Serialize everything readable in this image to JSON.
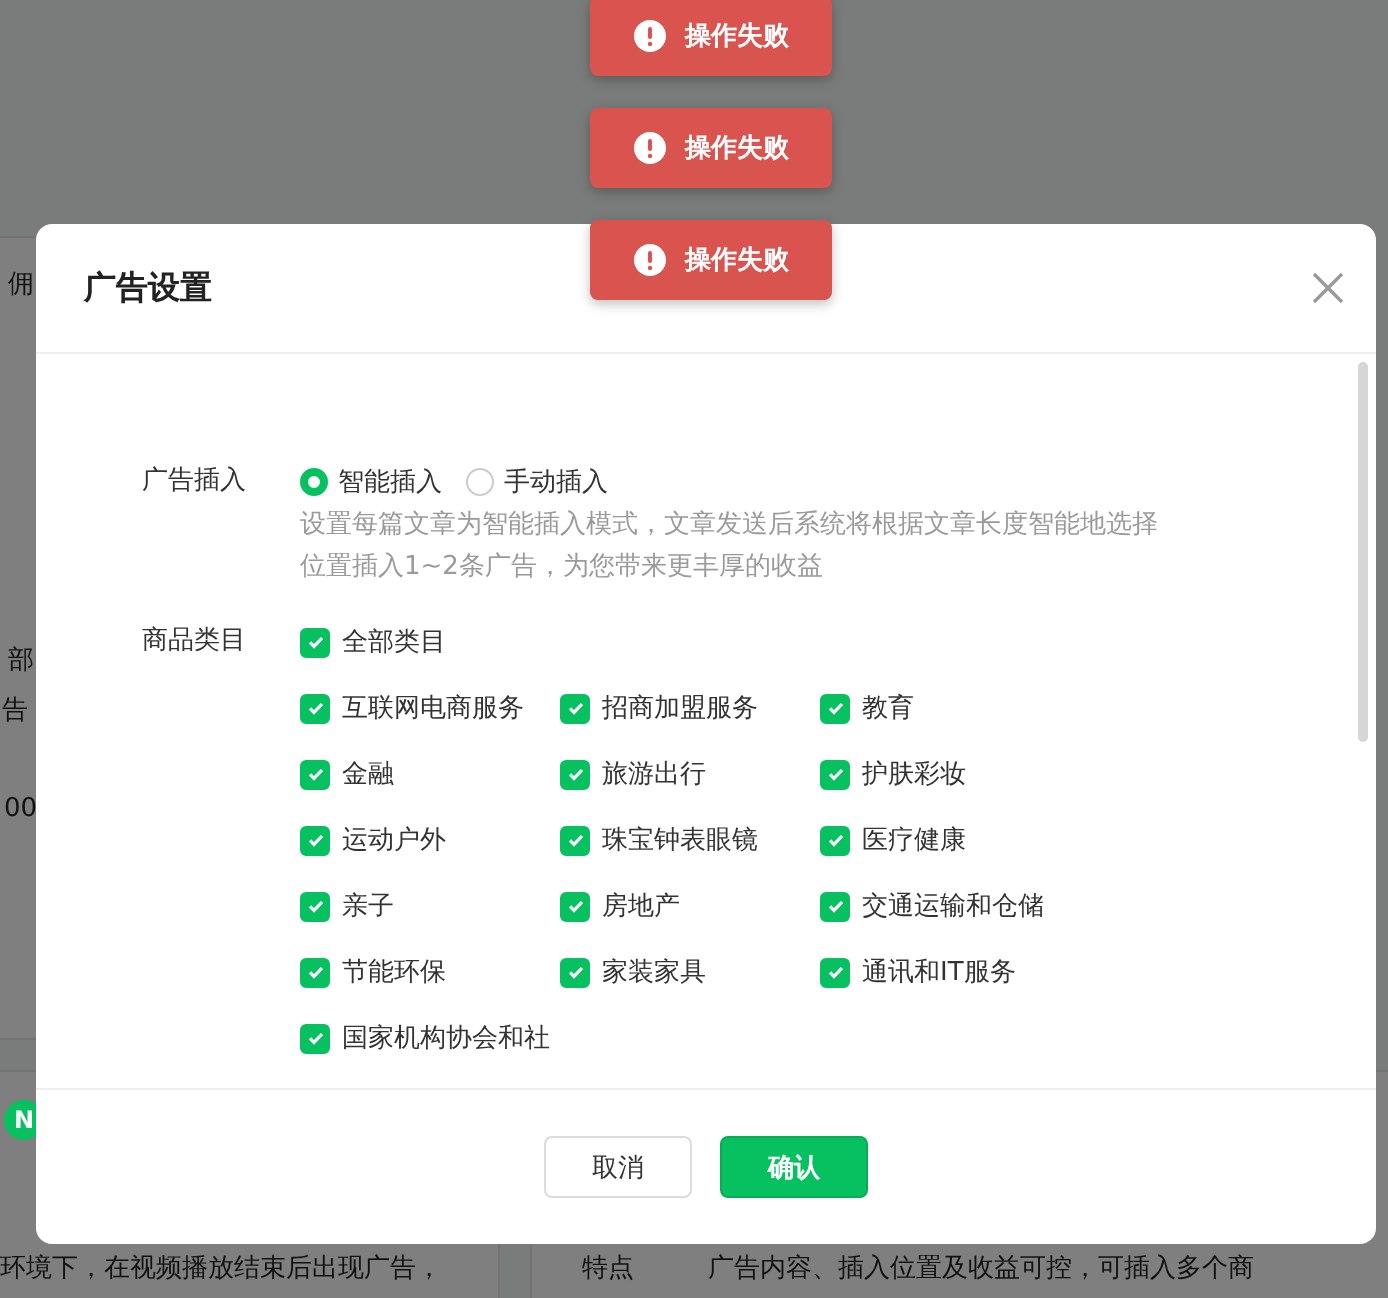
{
  "background": {
    "fragments": [
      {
        "kind": "text",
        "text": "佣"
      },
      {
        "kind": "text",
        "text": "部"
      },
      {
        "kind": "text",
        "text": "告"
      },
      {
        "kind": "text",
        "text": "00"
      },
      {
        "kind": "badge",
        "text": "N"
      },
      {
        "kind": "text",
        "text": "环境下，在视频播放结束后出现广告，"
      },
      {
        "kind": "text",
        "text": "特点"
      },
      {
        "kind": "text",
        "text": "广告内容、插入位置及收益可控，可插入多个商"
      }
    ]
  },
  "dialog": {
    "title": "广告设置",
    "ad_insert": {
      "label": "广告插入",
      "options": [
        {
          "label": "智能插入",
          "selected": true
        },
        {
          "label": "手动插入",
          "selected": false
        }
      ],
      "hint": "设置每篇文章为智能插入模式，文章发送后系统将根据文章长度智能地选择位置插入1~2条广告，为您带来更丰厚的收益"
    },
    "categories": {
      "label": "商品类目",
      "all": {
        "label": "全部类目",
        "checked": true
      },
      "items": [
        {
          "label": "互联网电商服务",
          "checked": true
        },
        {
          "label": "招商加盟服务",
          "checked": true
        },
        {
          "label": "教育",
          "checked": true
        },
        {
          "label": "金融",
          "checked": true
        },
        {
          "label": "旅游出行",
          "checked": true
        },
        {
          "label": "护肤彩妆",
          "checked": true
        },
        {
          "label": "运动户外",
          "checked": true
        },
        {
          "label": "珠宝钟表眼镜",
          "checked": true
        },
        {
          "label": "医疗健康",
          "checked": true
        },
        {
          "label": "亲子",
          "checked": true
        },
        {
          "label": "房地产",
          "checked": true
        },
        {
          "label": "交通运输和仓储",
          "checked": true
        },
        {
          "label": "节能环保",
          "checked": true
        },
        {
          "label": "家装家具",
          "checked": true
        },
        {
          "label": "通讯和IT服务",
          "checked": true
        },
        {
          "label": "国家机构协会和社",
          "checked": true
        }
      ]
    },
    "buttons": [
      {
        "kind": "cancel",
        "label": "取消"
      },
      {
        "kind": "confirm",
        "label": "确认"
      }
    ]
  },
  "toasts": [
    {
      "text": "操作失败"
    },
    {
      "text": "操作失败"
    },
    {
      "text": "操作失败"
    }
  ]
}
